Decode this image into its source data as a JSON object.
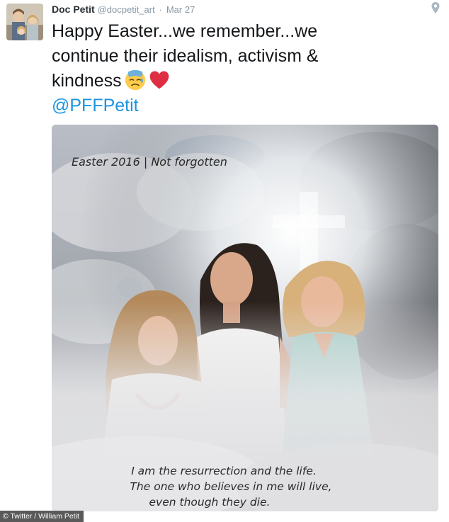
{
  "tweet": {
    "display_name": "Doc Petit",
    "handle": "@docpetit_art",
    "separator": "·",
    "timestamp": "Mar 27",
    "text_lines": [
      "Happy Easter...we remember...we",
      "continue their idealism, activism &",
      "kindness"
    ],
    "emojis": [
      "sad-sweat-face-emoji",
      "red-heart-emoji"
    ],
    "mention": "@PFFPetit"
  },
  "media": {
    "caption_top": "Easter 2016 | Not forgotten",
    "verse_lines": [
      "I am the resurrection and the life.",
      "The one who believes in me will live,",
      "even though they die."
    ]
  },
  "credit": "© Twitter / William Petit",
  "colors": {
    "link": "#1b95e0",
    "name": "#292f33",
    "meta": "#8899a6",
    "heart": "#dd2e44"
  }
}
